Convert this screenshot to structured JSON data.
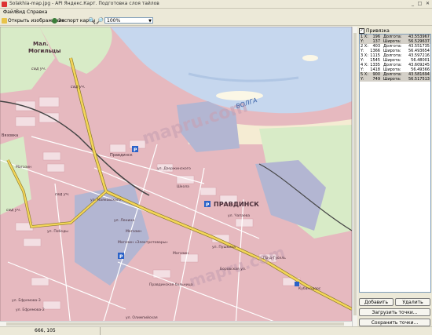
{
  "window": {
    "title": "Solakhia-map.jpg - API Яндекс.Карт. Подготовка слоя тайлов",
    "minimize": "_",
    "maximize": "□",
    "close": "✕"
  },
  "menu": [
    "Файл",
    "Вид",
    "Справка"
  ],
  "toolbar": {
    "open_image": "Открыть изображение",
    "export_map": "Экспорт карты",
    "zoom_value": "100%"
  },
  "map": {
    "watermark1": "mapru.com",
    "watermark2": "mapru.com",
    "river": "ВОЛГА",
    "city": "ПРАВДИНСК",
    "labels": [
      "Мал.",
      "Могильцы",
      "сад уч.",
      "сад уч.",
      "сад уч.",
      "сад уч.",
      "Вязовка",
      "Магазин",
      "Правдинск",
      "ул. Дзержинского",
      "ул. Чапаева",
      "Школа",
      "ул. Маяковского",
      "ул. Ленина",
      "ул. Победы",
      "Магазин",
      "Магазин «Электротовары»",
      "Магазин",
      "Кубанодорс",
      "Правдинская больница",
      "ул. Ефремова-3",
      "ул. Ефремова-2",
      "ул. Олимпийская",
      "Боровская ул.",
      "ул. Пушкина",
      "Пр-д-Гусель"
    ]
  },
  "sidebar": {
    "binding_label": "Привязка",
    "binding_checked": true,
    "points": [
      {
        "n": "1 X:",
        "v": "196",
        "k": "Долгота:",
        "c": "43.553967",
        "sel": true
      },
      {
        "n": "Y:",
        "v": "137",
        "k": "Широта:",
        "c": "56.529637",
        "sel": true
      },
      {
        "n": "2 X:",
        "v": "403",
        "k": "Долгота:",
        "c": "43.551735",
        "sel": false
      },
      {
        "n": "Y:",
        "v": "1366",
        "k": "Широта:",
        "c": "56.493654",
        "sel": false
      },
      {
        "n": "3 X:",
        "v": "1115",
        "k": "Долгота:",
        "c": "43.597216",
        "sel": false
      },
      {
        "n": "Y:",
        "v": "1545",
        "k": "Широта:",
        "c": "56.48001",
        "sel": false
      },
      {
        "n": "4 X:",
        "v": "1335",
        "k": "Долгота:",
        "c": "43.609245",
        "sel": false
      },
      {
        "n": "Y:",
        "v": "1418",
        "k": "Широта:",
        "c": "56.49366",
        "sel": false
      },
      {
        "n": "5 X:",
        "v": "900",
        "k": "Долгота:",
        "c": "43.581694",
        "sel": true
      },
      {
        "n": "Y:",
        "v": "749",
        "k": "Широта:",
        "c": "56.517513",
        "sel": true
      }
    ],
    "add_button": "Добавить",
    "delete_button": "Удалить",
    "load_points_button": "Загрузить точки...",
    "save_points_button": "Сохранить точки..."
  },
  "status": {
    "coords": "666, 105"
  }
}
